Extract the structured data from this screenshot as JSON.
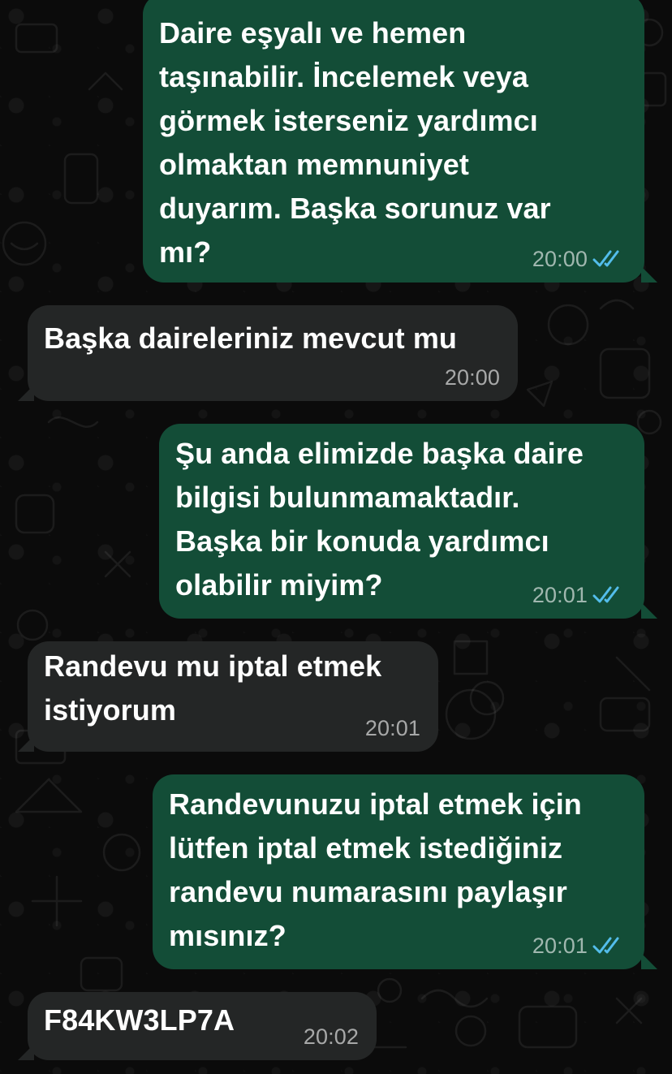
{
  "colors": {
    "outgoing_bubble": "#134d37",
    "incoming_bubble": "#242626",
    "background": "#0b0b0b",
    "read_ticks": "#53bdeb"
  },
  "messages": [
    {
      "direction": "outgoing",
      "text": "Daire eşyalı ve hemen\ntaşınabilir. İncelemek veya\ngörmek isterseniz yardımcı\nolmaktan memnuniyet\nduyarım. Başka sorunuz var\nmı?",
      "time": "20:00",
      "status_icon": "double-check-read-icon"
    },
    {
      "direction": "incoming",
      "text": "Başka daireleriniz mevcut  mu",
      "time": "20:00"
    },
    {
      "direction": "outgoing",
      "text": "Şu anda elimizde başka daire\nbilgisi bulunmamaktadır.\nBaşka bir konuda yardımcı\nolabilir miyim?",
      "time": "20:01",
      "status_icon": "double-check-read-icon"
    },
    {
      "direction": "incoming",
      "text": "Randevu mu iptal etmek\nistiyorum",
      "time": "20:01"
    },
    {
      "direction": "outgoing",
      "text": "Randevunuzu iptal etmek için\nlütfen iptal etmek istediğiniz\nrandevu numarasını paylaşır\nmısınız?",
      "time": "20:01",
      "status_icon": "double-check-read-icon"
    },
    {
      "direction": "incoming",
      "text": "F84KW3LP7A",
      "time": "20:02"
    }
  ]
}
